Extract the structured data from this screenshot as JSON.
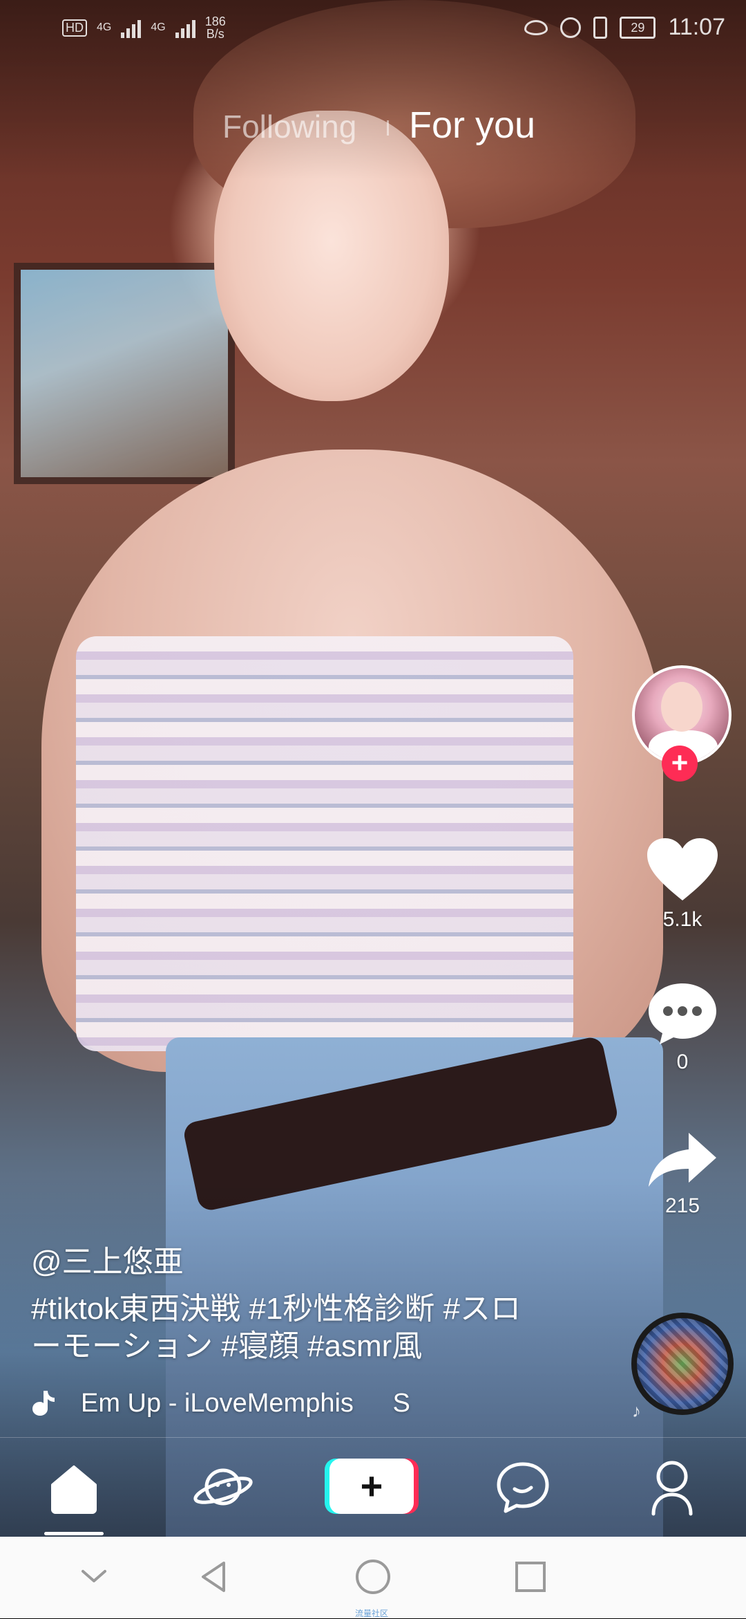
{
  "status_bar": {
    "network_left": "4G",
    "network_right": "4G",
    "speed_value": "186",
    "speed_unit": "B/s",
    "battery": "29",
    "time": "11:07"
  },
  "top_tabs": {
    "following": "Following",
    "for_you": "For you"
  },
  "video": {
    "author": "@三上悠亜",
    "caption": "#tiktok東西決戦 #1秒性格診断 #スローモーション #寝顔 #asmr風",
    "music": "Em Up - iLoveMemphis",
    "music_trailing": "S"
  },
  "rail": {
    "likes": "5.1k",
    "comments": "0",
    "shares": "215",
    "follow_symbol": "+"
  },
  "bottom_nav": {
    "create_symbol": "+"
  },
  "system_nav": {
    "watermark": "流量社区"
  },
  "colors": {
    "accent_red": "#fe2c55",
    "accent_cyan": "#25f4ee"
  },
  "icons": [
    "heart-icon",
    "comment-icon",
    "share-icon",
    "music-note-icon",
    "home-icon",
    "discover-icon",
    "create-icon",
    "inbox-icon",
    "profile-icon"
  ]
}
